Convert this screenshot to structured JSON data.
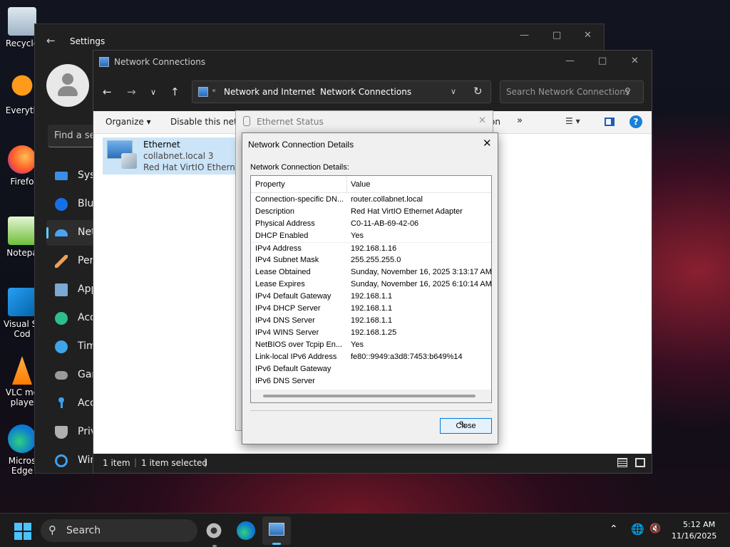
{
  "desktop": {
    "icons": [
      {
        "label": "Recycle"
      },
      {
        "label": "Everyth"
      },
      {
        "label": "Firefo"
      },
      {
        "label": "Notepa"
      },
      {
        "label": "Visual St\nCod"
      },
      {
        "label": "VLC me\nplaye"
      },
      {
        "label": "Micros\nEdge"
      }
    ]
  },
  "settings": {
    "title": "Settings",
    "search_placeholder": "Find a se",
    "nav": [
      {
        "label": "Syst"
      },
      {
        "label": "Blue"
      },
      {
        "label": "Net"
      },
      {
        "label": "Pers"
      },
      {
        "label": "App"
      },
      {
        "label": "Acc"
      },
      {
        "label": "Tim"
      },
      {
        "label": "Gar"
      },
      {
        "label": "Acc"
      },
      {
        "label": "Priv"
      },
      {
        "label": "Win"
      }
    ]
  },
  "netconn": {
    "title": "Network Connections",
    "breadcrumb": [
      "Network and Internet",
      "Network Connections"
    ],
    "search_placeholder": "Search Network Connections",
    "toolbar": {
      "organize": "Organize",
      "disable": "Disable this netwo",
      "partial": "on",
      "more": "»"
    },
    "item": {
      "name": "Ethernet",
      "network": "collabnet.local 3",
      "adapter": "Red Hat VirtIO Ethernet A"
    },
    "status": {
      "count": "1 item",
      "selected": "1 item selected"
    }
  },
  "ethstatus": {
    "title": "Ethernet Status"
  },
  "details": {
    "title": "Network Connection Details",
    "subtitle": "Network Connection Details:",
    "columns": [
      "Property",
      "Value"
    ],
    "rows": [
      {
        "p": "Connection-specific DN...",
        "v": "router.collabnet.local"
      },
      {
        "p": "Description",
        "v": "Red Hat VirtIO Ethernet Adapter"
      },
      {
        "p": "Physical Address",
        "v": "C0-11-AB-69-42-06"
      },
      {
        "p": "DHCP Enabled",
        "v": "Yes"
      },
      {
        "p": "IPv4 Address",
        "v": "192.168.1.16"
      },
      {
        "p": "IPv4 Subnet Mask",
        "v": "255.255.255.0"
      },
      {
        "p": "Lease Obtained",
        "v": "Sunday, November 16, 2025 3:13:17 AM"
      },
      {
        "p": "Lease Expires",
        "v": "Sunday, November 16, 2025 6:10:14 AM"
      },
      {
        "p": "IPv4 Default Gateway",
        "v": "192.168.1.1"
      },
      {
        "p": "IPv4 DHCP Server",
        "v": "192.168.1.1"
      },
      {
        "p": "IPv4 DNS Server",
        "v": "192.168.1.1"
      },
      {
        "p": "IPv4 WINS Server",
        "v": "192.168.1.25"
      },
      {
        "p": "NetBIOS over Tcpip En...",
        "v": "Yes"
      },
      {
        "p": "Link-local IPv6 Address",
        "v": "fe80::9949:a3d8:7453:b649%14"
      },
      {
        "p": "IPv6 Default Gateway",
        "v": ""
      },
      {
        "p": "IPv6 DNS Server",
        "v": ""
      }
    ],
    "close_label": "Close"
  },
  "taskbar": {
    "search": "Search",
    "time": "5:12 AM",
    "date": "11/16/2025"
  },
  "colors": {
    "accent": "#0078d7",
    "settings_accent": "#60cdff"
  }
}
